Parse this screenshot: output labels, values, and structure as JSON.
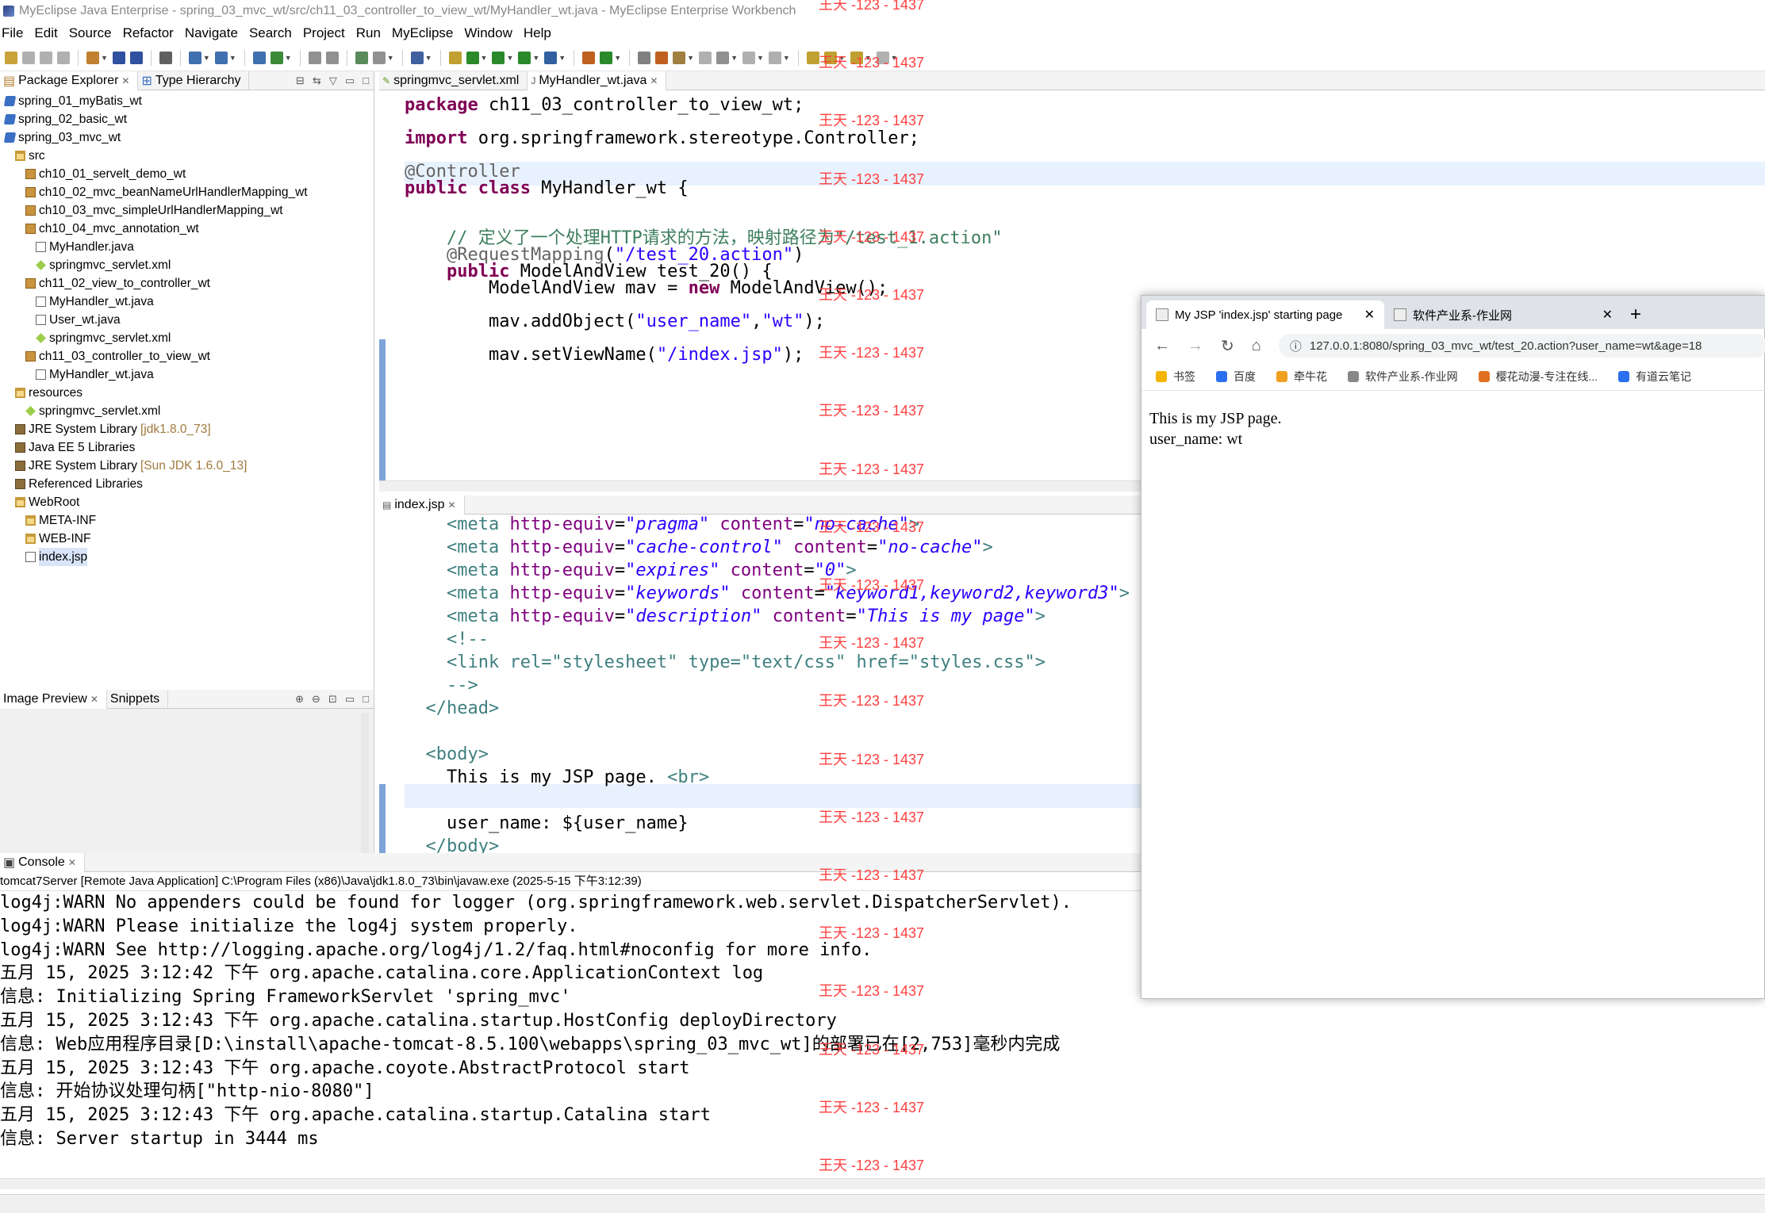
{
  "window": {
    "title": "MyEclipse Java Enterprise - spring_03_mvc_wt/src/ch11_03_controller_to_view_wt/MyHandler_wt.java - MyEclipse Enterprise Workbench"
  },
  "menu": [
    "File",
    "Edit",
    "Source",
    "Refactor",
    "Navigate",
    "Search",
    "Project",
    "Run",
    "MyEclipse",
    "Window",
    "Help"
  ],
  "package_explorer": {
    "tabs": [
      "Package Explorer",
      "Type Hierarchy"
    ],
    "tree": [
      {
        "label": "spring_01_myBatis_wt",
        "icon": "project-icon",
        "depth": 1
      },
      {
        "label": "spring_02_basic_wt",
        "icon": "project-icon",
        "depth": 1
      },
      {
        "label": "spring_03_mvc_wt",
        "icon": "project-icon",
        "depth": 1
      },
      {
        "label": "src",
        "icon": "folder-icon",
        "depth": 2
      },
      {
        "label": "ch10_01_servelt_demo_wt",
        "icon": "package-icon",
        "depth": 3
      },
      {
        "label": "ch10_02_mvc_beanNameUrlHandlerMapping_wt",
        "icon": "package-icon",
        "depth": 3
      },
      {
        "label": "ch10_03_mvc_simpleUrlHandlerMapping_wt",
        "icon": "package-icon",
        "depth": 3
      },
      {
        "label": "ch10_04_mvc_annotation_wt",
        "icon": "package-icon",
        "depth": 3
      },
      {
        "label": "MyHandler.java",
        "icon": "java-file-icon",
        "depth": 4
      },
      {
        "label": "springmvc_servlet.xml",
        "icon": "xml-file-icon",
        "depth": 4
      },
      {
        "label": "ch11_02_view_to_controller_wt",
        "icon": "package-icon",
        "depth": 3
      },
      {
        "label": "MyHandler_wt.java",
        "icon": "java-file-icon",
        "depth": 4
      },
      {
        "label": "User_wt.java",
        "icon": "java-file-icon",
        "depth": 4
      },
      {
        "label": "springmvc_servlet.xml",
        "icon": "xml-file-icon",
        "depth": 4
      },
      {
        "label": "ch11_03_controller_to_view_wt",
        "icon": "package-icon",
        "depth": 3
      },
      {
        "label": "MyHandler_wt.java",
        "icon": "java-file-icon",
        "depth": 4
      },
      {
        "label": "resources",
        "icon": "folder-icon",
        "depth": 2
      },
      {
        "label": "springmvc_servlet.xml",
        "icon": "xml-file-icon",
        "depth": 3
      },
      {
        "label": "JRE System Library",
        "suffix": "[jdk1.8.0_73]",
        "icon": "library-icon",
        "depth": 2
      },
      {
        "label": "Java EE 5 Libraries",
        "icon": "library-icon",
        "depth": 2
      },
      {
        "label": "JRE System Library",
        "suffix": "[Sun JDK 1.6.0_13]",
        "icon": "library-icon",
        "depth": 2
      },
      {
        "label": "Referenced Libraries",
        "icon": "library-icon",
        "depth": 2
      },
      {
        "label": "WebRoot",
        "icon": "folder-icon",
        "depth": 2
      },
      {
        "label": "META-INF",
        "icon": "folder-icon",
        "depth": 3
      },
      {
        "label": "WEB-INF",
        "icon": "folder-icon",
        "depth": 3
      },
      {
        "label": "index.jsp",
        "icon": "jsp-file-icon",
        "depth": 3,
        "selected": true
      }
    ]
  },
  "preview_panel": {
    "tabs": [
      "Image Preview",
      "Snippets"
    ]
  },
  "editor_top": {
    "tabs": [
      "springmvc_servlet.xml",
      "MyHandler_wt.java"
    ],
    "active_tab": 1,
    "lines": [
      [
        {
          "t": "package",
          "c": "kw"
        },
        {
          "t": " ch11_03_controller_to_view_wt;"
        }
      ],
      [],
      [
        {
          "t": "import",
          "c": "kw"
        },
        {
          "t": " org.springframework.stereotype.Controller;"
        }
      ],
      [],
      [
        {
          "t": "@Controller",
          "c": "ann"
        }
      ],
      [
        {
          "t": "public",
          "c": "kw"
        },
        {
          "t": " "
        },
        {
          "t": "class",
          "c": "kw"
        },
        {
          "t": " MyHandler_wt {"
        }
      ],
      [],
      [],
      [
        {
          "t": "    "
        },
        {
          "t": "// 定义了一个处理HTTP请求的方法，映射路径为\"/test_1.action\"",
          "c": "cmt"
        }
      ],
      [
        {
          "t": "    "
        },
        {
          "t": "@RequestMapping",
          "c": "ann"
        },
        {
          "t": "("
        },
        {
          "t": "\"/test_20.action\"",
          "c": "str"
        },
        {
          "t": ")"
        }
      ],
      [
        {
          "t": "    "
        },
        {
          "t": "public",
          "c": "kw"
        },
        {
          "t": " ModelAndView test_20() {"
        }
      ],
      [
        {
          "t": "        ModelAndView mav = "
        },
        {
          "t": "new",
          "c": "kw"
        },
        {
          "t": " ModelAndView();"
        }
      ],
      [],
      [
        {
          "t": "        mav.addObject("
        },
        {
          "t": "\"user_name\"",
          "c": "str"
        },
        {
          "t": ","
        },
        {
          "t": "\"wt\"",
          "c": "str"
        },
        {
          "t": ");"
        }
      ],
      [],
      [
        {
          "t": "        mav.setViewName("
        },
        {
          "t": "\"/index.jsp\"",
          "c": "str"
        },
        {
          "t": ");"
        }
      ]
    ]
  },
  "editor_bottom": {
    "tabs": [
      "index.jsp"
    ],
    "lines": [
      [
        {
          "t": "    "
        },
        {
          "t": "<meta ",
          "c": "tag"
        },
        {
          "t": "http-equiv",
          "c": "attr"
        },
        {
          "t": "="
        },
        {
          "t": "\"pragma\"",
          "c": "aval"
        },
        {
          "t": " "
        },
        {
          "t": "content",
          "c": "attr"
        },
        {
          "t": "="
        },
        {
          "t": "\"no-cache\"",
          "c": "aval"
        },
        {
          "t": ">",
          "c": "tag"
        }
      ],
      [
        {
          "t": "    "
        },
        {
          "t": "<meta ",
          "c": "tag"
        },
        {
          "t": "http-equiv",
          "c": "attr"
        },
        {
          "t": "="
        },
        {
          "t": "\"cache-control\"",
          "c": "aval"
        },
        {
          "t": " "
        },
        {
          "t": "content",
          "c": "attr"
        },
        {
          "t": "="
        },
        {
          "t": "\"no-cache\"",
          "c": "aval"
        },
        {
          "t": ">",
          "c": "tag"
        }
      ],
      [
        {
          "t": "    "
        },
        {
          "t": "<meta ",
          "c": "tag"
        },
        {
          "t": "http-equiv",
          "c": "attr"
        },
        {
          "t": "="
        },
        {
          "t": "\"expires\"",
          "c": "aval"
        },
        {
          "t": " "
        },
        {
          "t": "content",
          "c": "attr"
        },
        {
          "t": "="
        },
        {
          "t": "\"0\"",
          "c": "aval"
        },
        {
          "t": ">",
          "c": "tag"
        }
      ],
      [
        {
          "t": "    "
        },
        {
          "t": "<meta ",
          "c": "tag"
        },
        {
          "t": "http-equiv",
          "c": "attr"
        },
        {
          "t": "="
        },
        {
          "t": "\"keywords\"",
          "c": "aval"
        },
        {
          "t": " "
        },
        {
          "t": "content",
          "c": "attr"
        },
        {
          "t": "="
        },
        {
          "t": "\"keyword1,keyword2,keyword3\"",
          "c": "aval"
        },
        {
          "t": ">",
          "c": "tag"
        }
      ],
      [
        {
          "t": "    "
        },
        {
          "t": "<meta ",
          "c": "tag"
        },
        {
          "t": "http-equiv",
          "c": "attr"
        },
        {
          "t": "="
        },
        {
          "t": "\"description\"",
          "c": "aval"
        },
        {
          "t": " "
        },
        {
          "t": "content",
          "c": "attr"
        },
        {
          "t": "="
        },
        {
          "t": "\"This is my page\"",
          "c": "aval"
        },
        {
          "t": ">",
          "c": "tag"
        }
      ],
      [
        {
          "t": "    "
        },
        {
          "t": "<!--",
          "c": "tag"
        }
      ],
      [
        {
          "t": "    "
        },
        {
          "t": "<link rel=\"stylesheet\" type=\"text/css\" href=\"styles.css\">",
          "c": "tag"
        }
      ],
      [
        {
          "t": "    "
        },
        {
          "t": "-->",
          "c": "tag"
        }
      ],
      [
        {
          "t": "  "
        },
        {
          "t": "</head>",
          "c": "tag"
        }
      ],
      [],
      [
        {
          "t": "  "
        },
        {
          "t": "<body>",
          "c": "tag"
        }
      ],
      [
        {
          "t": "    This is my JSP page. "
        },
        {
          "t": "<br>",
          "c": "tag"
        }
      ],
      [],
      [
        {
          "t": "    user_name: ${user_name}"
        }
      ],
      [
        {
          "t": "  "
        },
        {
          "t": "</body>",
          "c": "tag"
        }
      ]
    ]
  },
  "console": {
    "tab": "Console",
    "header": "tomcat7Server [Remote Java Application] C:\\Program Files (x86)\\Java\\jdk1.8.0_73\\bin\\javaw.exe (2025-5-15 下午3:12:39)",
    "lines": [
      "log4j:WARN No appenders could be found for logger (org.springframework.web.servlet.DispatcherServlet).",
      "log4j:WARN Please initialize the log4j system properly.",
      "log4j:WARN See http://logging.apache.org/log4j/1.2/faq.html#noconfig for more info.",
      "五月 15, 2025 3:12:42 下午 org.apache.catalina.core.ApplicationContext log",
      "信息: Initializing Spring FrameworkServlet 'spring_mvc'",
      "五月 15, 2025 3:12:43 下午 org.apache.catalina.startup.HostConfig deployDirectory",
      "信息: Web应用程序目录[D:\\install\\apache-tomcat-8.5.100\\webapps\\spring_03_mvc_wt]的部署已在[2,753]毫秒内完成",
      "五月 15, 2025 3:12:43 下午 org.apache.coyote.AbstractProtocol start",
      "信息: 开始协议处理句柄[\"http-nio-8080\"]",
      "五月 15, 2025 3:12:43 下午 org.apache.catalina.startup.Catalina start",
      "信息: Server startup in 3444 ms"
    ]
  },
  "watermark": "王天 -123 - 1437",
  "browser": {
    "tabs": [
      {
        "title": "My JSP 'index.jsp' starting page"
      },
      {
        "title": "软件产业系-作业网"
      }
    ],
    "url": "127.0.0.1:8080/spring_03_mvc_wt/test_20.action?user_name=wt&age=18",
    "bookmarks": [
      "书签",
      "百度",
      "牵牛花",
      "软件产业系-作业网",
      "樱花动漫-专注在线...",
      "有道云笔记"
    ],
    "content": [
      "This is my JSP page.",
      "user_name: wt"
    ]
  }
}
